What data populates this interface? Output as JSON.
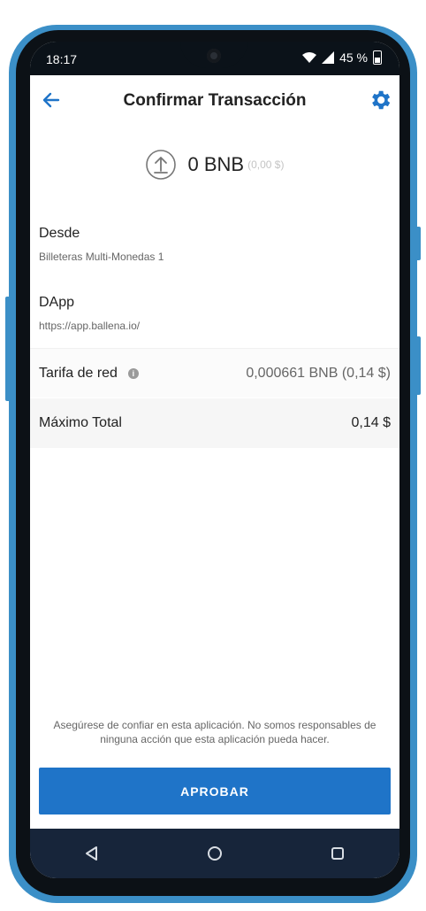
{
  "status_bar": {
    "time": "18:17",
    "battery": "45 %"
  },
  "header": {
    "title": "Confirmar Transacción"
  },
  "amount": {
    "value": "0 BNB",
    "fiat": "(0,00 $)"
  },
  "from": {
    "label": "Desde",
    "value": "Billeteras Multi-Monedas 1"
  },
  "dapp": {
    "label": "DApp",
    "value": "https://app.ballena.io/"
  },
  "network_fee": {
    "label": "Tarifa de red",
    "value": "0,000661 BNB (0,14 $)"
  },
  "total": {
    "label": "Máximo Total",
    "value": "0,14 $"
  },
  "disclaimer": "Asegúrese de confiar en esta aplicación. No somos responsables de ninguna acción que esta aplicación pueda hacer.",
  "approve_button": "APROBAR",
  "colors": {
    "accent": "#1f74c8",
    "nav": "#17253a",
    "status": "#0b1219",
    "frame": "#3b8fc7"
  }
}
